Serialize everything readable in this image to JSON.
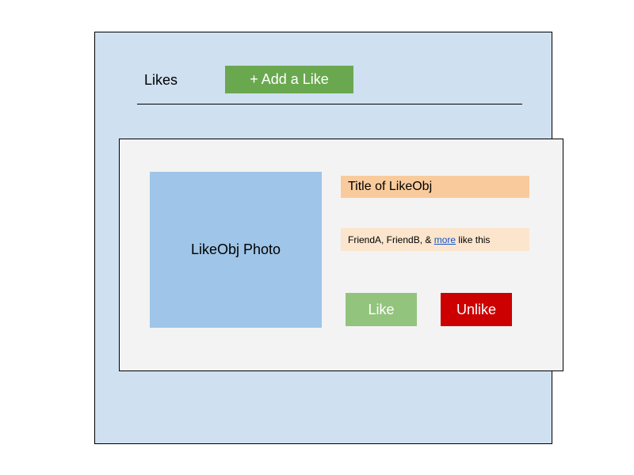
{
  "header": {
    "title": "Likes",
    "add_button_label": "+ Add a Like"
  },
  "card": {
    "photo_label": "LikeObj Photo",
    "title": "Title of LikeObj",
    "friends_prefix": "FriendA, FriendB, & ",
    "more_link": "more",
    "friends_suffix": " like this",
    "like_label": "Like",
    "unlike_label": "Unlike"
  },
  "colors": {
    "panel_background": "#cfe0f1",
    "add_button": "#6aa84f",
    "card_background": "#f3f3f3",
    "photo_placeholder": "#9fc5e8",
    "title_background": "#f9cb9c",
    "friends_background": "#fce5cd",
    "like_button": "#93c47d",
    "unlike_button": "#cc0000",
    "link": "#1155cc"
  }
}
